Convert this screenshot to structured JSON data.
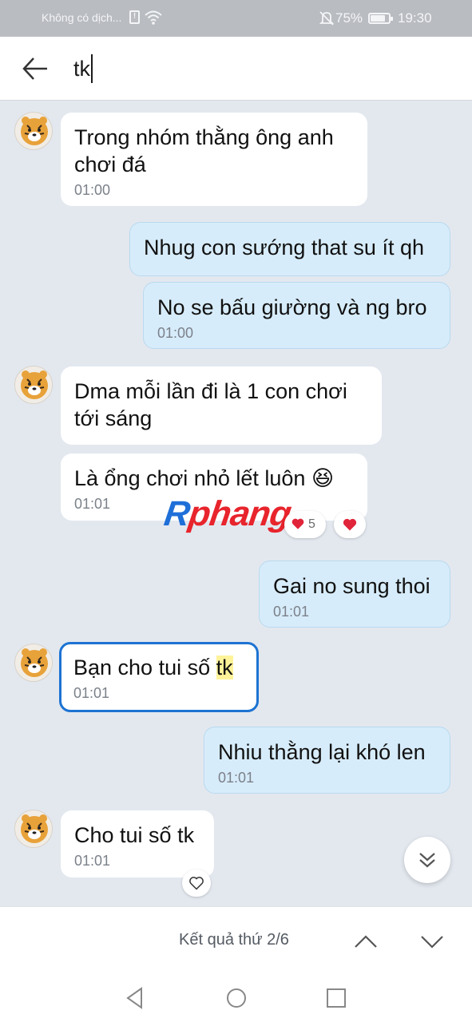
{
  "status_bar": {
    "carrier": "Không có dịch...",
    "battery_percent": "75%",
    "battery_level": 0.75,
    "time": "19:30",
    "icons": [
      "sim-icon",
      "wifi-icon",
      "mute-icon",
      "battery-icon"
    ]
  },
  "search": {
    "query": "tk"
  },
  "messages": [
    {
      "dir": "in",
      "text": "Trong nhóm thằng ông anh chơi đá",
      "time": "01:00"
    },
    {
      "dir": "out",
      "text": "Nhug con sướng that su ít qh",
      "time": ""
    },
    {
      "dir": "out",
      "text": "No se bấu giường và ng bro",
      "time": "01:00"
    },
    {
      "dir": "in",
      "text": "Dma mỗi lần đi là 1 con chơi tới sáng",
      "time": ""
    },
    {
      "dir": "in",
      "text": "Là ổng chơi nhỏ lết luôn",
      "emoji": "😆",
      "time": "01:01"
    },
    {
      "dir": "out",
      "text": "Gai no sung thoi",
      "time": "01:01"
    },
    {
      "dir": "in",
      "text_before": "Bạn cho tui số ",
      "highlight": "tk",
      "time": "01:01",
      "selected": true
    },
    {
      "dir": "out",
      "text": "Nhiu thằng lại khó len",
      "time": "01:01"
    },
    {
      "dir": "in",
      "text": "Cho tui số tk",
      "time": "01:01"
    }
  ],
  "reactions": {
    "heart_count": "5"
  },
  "watermark": {
    "part1": "R",
    "part2": "phang"
  },
  "result_bar": {
    "text": "Kết quả thứ 2/6"
  },
  "colors": {
    "incoming_bubble": "#ffffff",
    "outgoing_bubble": "#d7ecfa",
    "chat_background": "#e3e8ef",
    "selection_border": "#1d73d2",
    "highlight": "#fff39a"
  }
}
